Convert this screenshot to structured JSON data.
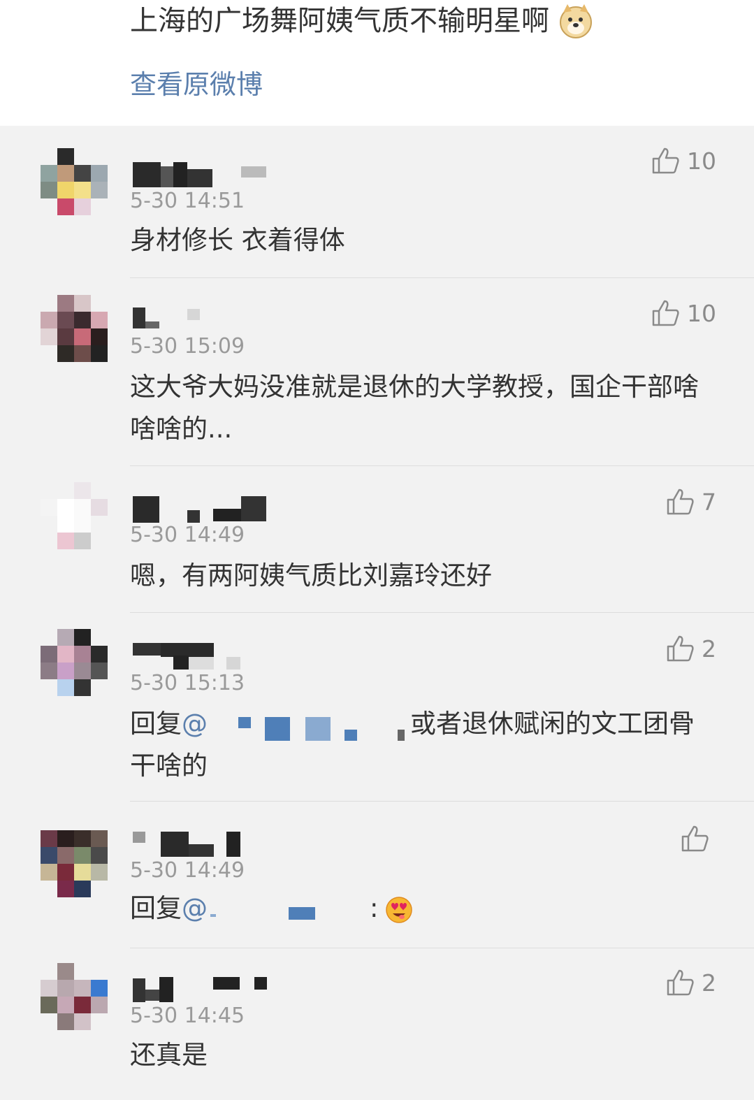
{
  "post": {
    "text": "上海的广场舞阿姨气质不输明星啊",
    "emoji": "doge-emoji",
    "view_original": "查看原微博"
  },
  "comments": [
    {
      "timestamp": "5-30 14:51",
      "text": "身材修长 衣着得体",
      "likes": "10"
    },
    {
      "timestamp": "5-30 15:09",
      "text": "这大爷大妈没准就是退休的大学教授，国企干部啥啥啥的...",
      "likes": "10"
    },
    {
      "timestamp": "5-30 14:49",
      "text": "嗯，有两阿姨气质比刘嘉玲还好",
      "likes": "7"
    },
    {
      "timestamp": "5-30 15:13",
      "reply_prefix": "回复",
      "reply_mention": "@",
      "text": "或者退休赋闲的文工团骨干啥的",
      "likes": "2"
    },
    {
      "timestamp": "5-30 14:49",
      "reply_prefix": "回复",
      "reply_mention": "@",
      "reply_suffix": ":",
      "emoji": "heart-eyes-emoji",
      "likes": ""
    },
    {
      "timestamp": "5-30 14:45",
      "text": "还真是",
      "likes": "2"
    }
  ],
  "colors": {
    "background": "#f2f2f2",
    "link": "#5b7fad",
    "text": "#333333",
    "meta": "#9a9a9a"
  }
}
